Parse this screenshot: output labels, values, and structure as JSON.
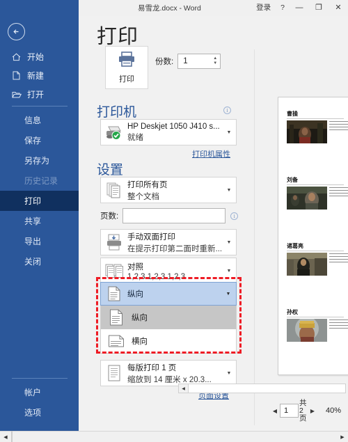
{
  "titlebar": {
    "document_title": "易雪龙.docx  -  Word",
    "signin_label": "登录",
    "help_label": "?",
    "minimize_label": "—",
    "maximize_label": "❐",
    "close_label": "✕"
  },
  "page": {
    "title": "打印"
  },
  "sidebar": {
    "back_icon": "back-arrow-icon",
    "top_items": [
      {
        "label": "开始",
        "icon": "home-icon"
      },
      {
        "label": "新建",
        "icon": "new-document-icon"
      },
      {
        "label": "打开",
        "icon": "open-folder-icon"
      }
    ],
    "items": [
      {
        "label": "信息",
        "state": "normal"
      },
      {
        "label": "保存",
        "state": "normal"
      },
      {
        "label": "另存为",
        "state": "normal"
      },
      {
        "label": "历史记录",
        "state": "disabled"
      },
      {
        "label": "打印",
        "state": "active"
      },
      {
        "label": "共享",
        "state": "normal"
      },
      {
        "label": "导出",
        "state": "normal"
      },
      {
        "label": "关闭",
        "state": "normal"
      }
    ],
    "bottom_items": [
      {
        "label": "帐户"
      },
      {
        "label": "选项"
      }
    ],
    "accent_color": "#2b579a",
    "active_color": "#10305f"
  },
  "print": {
    "button_label": "打印",
    "button_icon": "printer-icon",
    "copies_label": "份数:",
    "copies_value": "1"
  },
  "printer": {
    "section_title": "打印机",
    "name": "HP Deskjet 1050 J410 s...",
    "status": "就绪",
    "properties_link": "打印机属性",
    "icon": "printer-ready-icon"
  },
  "settings": {
    "section_title": "设置",
    "range": {
      "title": "打印所有页",
      "subtitle": "整个文档",
      "icon": "pages-icon"
    },
    "pages_label": "页数:",
    "pages_value": "",
    "pages_placeholder": "",
    "duplex": {
      "title": "手动双面打印",
      "subtitle": "在提示打印第二面时重新...",
      "icon": "duplex-icon"
    },
    "collate": {
      "title": "对照",
      "subtitle": "1,2,3   1,2,3   1,2,3",
      "icon": "collate-icon"
    },
    "orientation": {
      "selected": "纵向",
      "icon": "portrait-icon",
      "options": [
        {
          "label": "纵向",
          "icon": "portrait-icon",
          "highlighted": true
        },
        {
          "label": "横向",
          "icon": "landscape-icon",
          "highlighted": false
        }
      ],
      "highlight_color": "#ee1c25"
    },
    "pages_per_sheet": {
      "title": "每版打印 1 页",
      "subtitle": "缩放到 14 厘米 x 20.3...",
      "icon": "scale-icon"
    },
    "page_setup_link": "页面设置"
  },
  "preview": {
    "entries": [
      {
        "name": "曹操"
      },
      {
        "name": "刘备"
      },
      {
        "name": "诸葛亮"
      },
      {
        "name": "孙权"
      }
    ],
    "current_page": "1",
    "total_pages": "共 2 页",
    "total_pages_line1": "共",
    "total_pages_line2": "2",
    "total_pages_line3": "页",
    "zoom": "40%",
    "prev_page_icon": "left-triangle-icon",
    "next_page_icon": "right-triangle-icon"
  }
}
